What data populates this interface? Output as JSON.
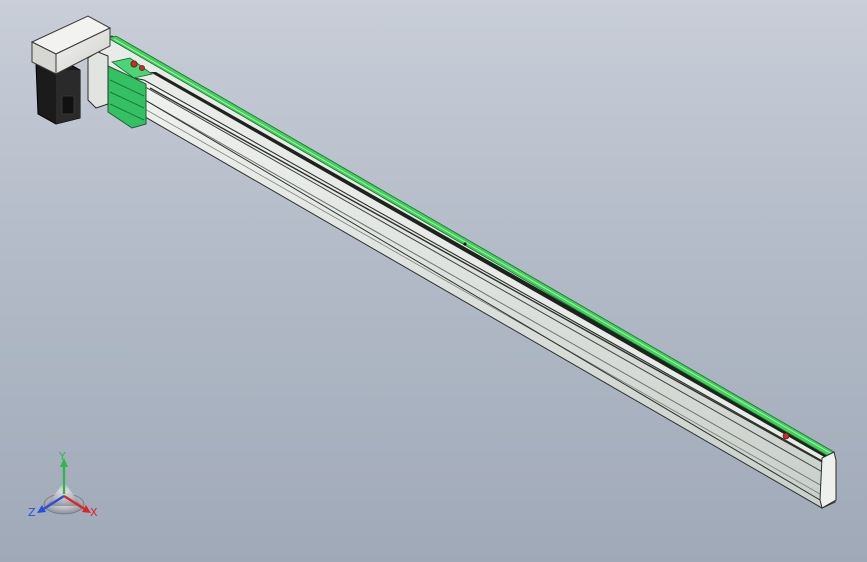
{
  "viewport": {
    "background_top": "#c9ced8",
    "background_bottom": "#a0a9b8"
  },
  "model": {
    "profile_color": "#dfe3df",
    "profile_edge": "#2a2f2a",
    "rail_cover_color": "#3fd15a",
    "carriage_color": "#34c063",
    "motor_housing_color": "#e6e6e3",
    "motor_body_color": "#1b1b1b",
    "marker_color": "#c62d2d"
  },
  "triad": {
    "x_label": "X",
    "y_label": "Y",
    "z_label": "Z",
    "x_color": "#d9262a",
    "y_color": "#2fb84a",
    "z_color": "#2a4fd8"
  }
}
